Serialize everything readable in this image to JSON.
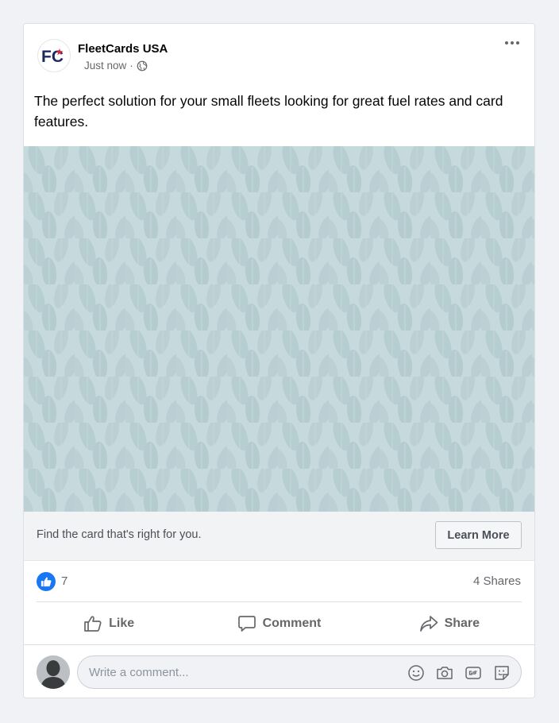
{
  "post": {
    "page_name": "FleetCards USA",
    "timestamp": "Just now",
    "separator": "·",
    "logo_text": "FC",
    "caption": "The perfect solution for your small fleets looking for great fuel rates and card features."
  },
  "cta": {
    "text": "Find the card that's right for you.",
    "button_label": "Learn More"
  },
  "stats": {
    "likes": "7",
    "shares": "4 Shares"
  },
  "actions": {
    "like": "Like",
    "comment": "Comment",
    "share": "Share"
  },
  "composer": {
    "placeholder": "Write a comment..."
  },
  "colors": {
    "brand_navy": "#1d2a5c",
    "brand_red": "#d7263d",
    "like_blue": "#1877f2",
    "media_bg": "#c6dadd"
  }
}
